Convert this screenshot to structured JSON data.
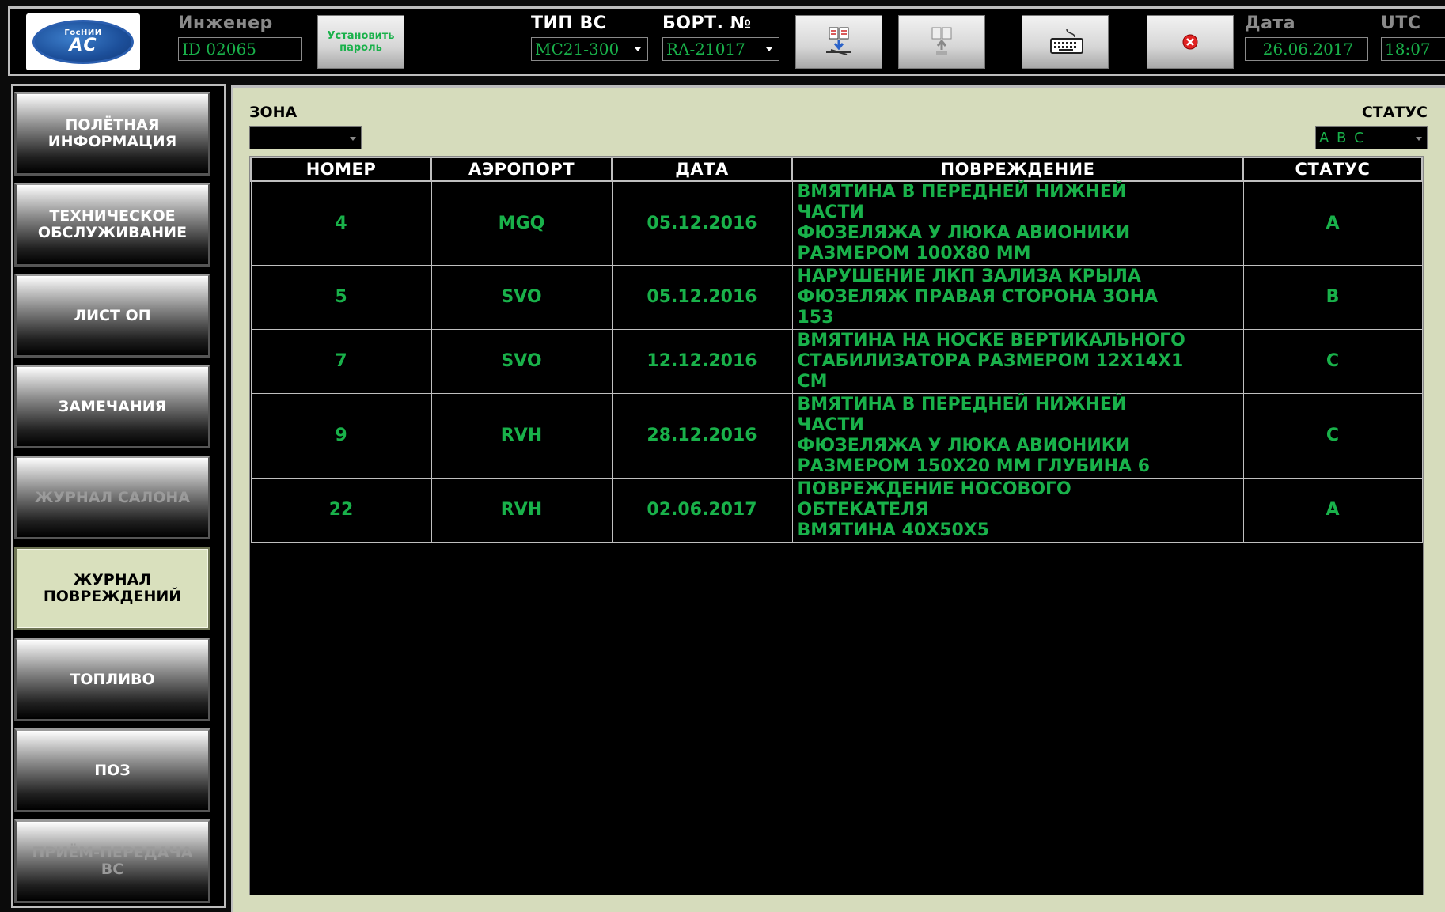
{
  "header": {
    "logo_text_top": "ГосНИИ",
    "logo_text_bottom": "АС",
    "engineer_label": "Инженер",
    "engineer_id": "ID 02065",
    "set_password_line1": "Установить",
    "set_password_line2": "пароль",
    "aircraft_type_label": "ТИП ВС",
    "aircraft_type_value": "MC21-300",
    "board_label": "БОРТ. №",
    "board_value": "RA-21017",
    "date_label": "Дата",
    "date_value": "26.06.2017",
    "utc_label": "UTC",
    "utc_value": "18:07",
    "icons": [
      "download-manual-icon",
      "upload-document-icon",
      "keyboard-icon",
      "close-icon"
    ]
  },
  "sidebar": {
    "items": [
      {
        "label": "ПОЛЁТНАЯ\nИНФОРМАЦИЯ",
        "state": "normal"
      },
      {
        "label": "ТЕХНИЧЕСКОЕ\nОБСЛУЖИВАНИЕ",
        "state": "normal"
      },
      {
        "label": "ЛИСТ ОП",
        "state": "normal"
      },
      {
        "label": "ЗАМЕЧАНИЯ",
        "state": "normal"
      },
      {
        "label": "ЖУРНАЛ САЛОНА",
        "state": "disabled"
      },
      {
        "label": "ЖУРНАЛ\nПОВРЕЖДЕНИЙ",
        "state": "active"
      },
      {
        "label": "ТОПЛИВО",
        "state": "normal"
      },
      {
        "label": "ПОЗ",
        "state": "normal"
      },
      {
        "label": "ПРИЁМ-ПЕРЕДАЧА\nВС",
        "state": "disabled"
      }
    ]
  },
  "filters": {
    "zone_label": "ЗОНА",
    "zone_value": "",
    "status_label": "СТАТУС",
    "status_value": "A B C"
  },
  "table": {
    "columns": [
      "НОМЕР",
      "АЭРОПОРТ",
      "ДАТА",
      "ПОВРЕЖДЕНИЕ",
      "СТАТУС"
    ],
    "rows": [
      {
        "number": "4",
        "airport": "MGQ",
        "date": "05.12.2016",
        "damage": "ВМЯТИНА В ПЕРЕДНЕЙ НИЖНЕЙ\nЧАСТИ\nФЮЗЕЛЯЖА У ЛЮКА АВИОНИКИ\nРАЗМЕРОМ 100Х80 ММ",
        "status": "A"
      },
      {
        "number": "5",
        "airport": "SVO",
        "date": "05.12.2016",
        "damage": "НАРУШЕНИЕ ЛКП ЗАЛИЗА КРЫЛА\nФЮЗЕЛЯЖ ПРАВАЯ СТОРОНА ЗОНА\n153",
        "status": "B"
      },
      {
        "number": "7",
        "airport": "SVO",
        "date": "12.12.2016",
        "damage": "ВМЯТИНА НА НОСКЕ ВЕРТИКАЛЬНОГО\nСТАБИЛИЗАТОРА РАЗМЕРОМ 12Х14Х1\nСМ",
        "status": "C"
      },
      {
        "number": "9",
        "airport": "RVH",
        "date": "28.12.2016",
        "damage": "ВМЯТИНА В ПЕРЕДНЕЙ НИЖНЕЙ\nЧАСТИ\nФЮЗЕЛЯЖА У ЛЮКА АВИОНИКИ\nРАЗМЕРОМ 150Х20 ММ ГЛУБИНА 6",
        "status": "C"
      },
      {
        "number": "22",
        "airport": "RVH",
        "date": "02.06.2017",
        "damage": "ПОВРЕЖДЕНИЕ НОСОВОГО\nОБТЕКАТЕЛЯ\nВМЯТИНА 40Х50Х5",
        "status": "A"
      }
    ]
  },
  "colors": {
    "accent_green": "#19b14a",
    "panel_background": "#d6dcbc",
    "active_nav": "#d9e0bd"
  }
}
